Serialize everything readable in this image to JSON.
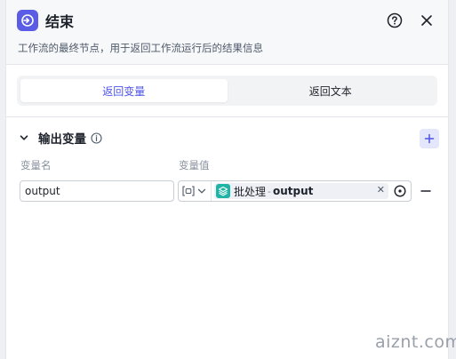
{
  "header": {
    "title": "结束",
    "description": "工作流的最终节点，用于返回工作流运行后的结果信息",
    "icons": {
      "node": "end-node-icon",
      "help": "help-circle-icon",
      "close": "close-icon"
    }
  },
  "tabs": [
    {
      "label": "返回变量",
      "active": true
    },
    {
      "label": "返回文本",
      "active": false
    }
  ],
  "output_section": {
    "title": "输出变量",
    "columns": {
      "name": "变量名",
      "value": "变量值"
    },
    "rows": [
      {
        "name": "output",
        "type_icon": "array-object-icon",
        "ref_node": "批处理",
        "ref_separator": "-",
        "ref_var": "output"
      }
    ]
  },
  "watermark": "aiznt.com",
  "colors": {
    "accent": "#4d53e8",
    "node_icon": "#5b5ce6",
    "batch_icon": "#1fb4a6"
  }
}
